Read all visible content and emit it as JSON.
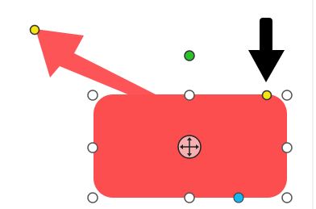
{
  "editor": {
    "mode": "shape-selected",
    "selected_shape": "rounded-callout-rectangle",
    "colors": {
      "shape_fill": "#fc4d4f",
      "arrow_fill": "#fc5457",
      "handle_fill": "#ffffff",
      "handle_stroke": "#555555",
      "adjust_handle_fill": "#f5e613",
      "rotate_handle_fill": "#2bc12b",
      "connector_handle_fill": "#17b6f0",
      "move_handle_fill": "#f6b0b1",
      "annotation_arrow_fill": "#000000",
      "guide_line": "#e6e6e6"
    },
    "icons": {
      "move": "four-way-move-icon",
      "annotation": "down-arrow-icon"
    }
  }
}
